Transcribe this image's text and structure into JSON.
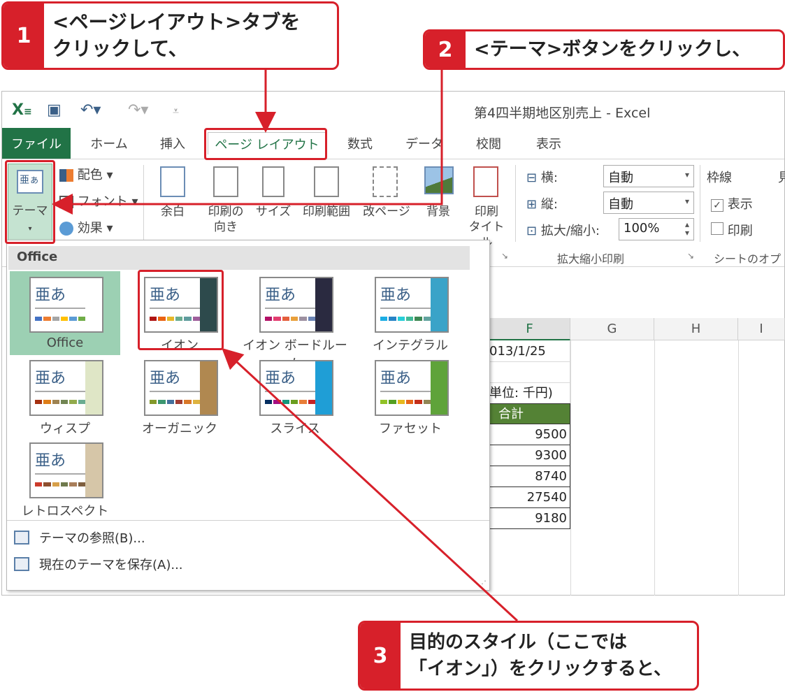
{
  "callouts": [
    {
      "num": "1",
      "text": "<ページレイアウト>タブを\nクリックして、"
    },
    {
      "num": "2",
      "text": "<テーマ>ボタンをクリックし、"
    },
    {
      "num": "3",
      "text": "目的のスタイル（ここでは\n「イオン」）をクリックすると、"
    }
  ],
  "window": {
    "title": "第4四半期地区別売上 - Excel"
  },
  "tabs": [
    "ファイル",
    "ホーム",
    "挿入",
    "ページ レイアウト",
    "数式",
    "データ",
    "校閲",
    "表示"
  ],
  "ribbon": {
    "theme_button": "テーマ",
    "theme_options": [
      "配色",
      "フォント",
      "効果"
    ],
    "page_setup": [
      {
        "label": "余白"
      },
      {
        "label": "印刷の\n向き"
      },
      {
        "label": "サイズ"
      },
      {
        "label": "印刷範囲"
      },
      {
        "label": "改ページ"
      },
      {
        "label": "背景"
      },
      {
        "label": "印刷\nタイトル"
      }
    ],
    "scale": {
      "width_label": "横:",
      "width_value": "自動",
      "height_label": "縦:",
      "height_value": "自動",
      "zoom_label": "拡大/縮小:",
      "zoom_value": "100%",
      "group_label": "拡大縮小印刷"
    },
    "gridlines": {
      "group_title": "枠線",
      "view_label": "表示",
      "print_label": "印刷",
      "view_checked": true,
      "print_checked": false,
      "group_label": "シートのオプ",
      "next_group_fragment": "見"
    }
  },
  "gallery": {
    "header": "Office",
    "themes": [
      {
        "name": "Office",
        "colors": [
          "#4472c4",
          "#ed7d31",
          "#a5a5a5",
          "#ffc000",
          "#5b9bd5",
          "#70ad47"
        ],
        "side": "#ffffff",
        "selected": true
      },
      {
        "name": "イオン",
        "colors": [
          "#b01513",
          "#ea6312",
          "#e6b729",
          "#6aac90",
          "#5f9c9d",
          "#9e5e9b"
        ],
        "side": "#2d4a4c"
      },
      {
        "name": "イオン ボードルーム",
        "colors": [
          "#b31166",
          "#e33d6f",
          "#e45f3c",
          "#e9a03b",
          "#9d90a0",
          "#6c85b6"
        ],
        "side": "#2a2a40"
      },
      {
        "name": "インテグラル",
        "colors": [
          "#1cade4",
          "#2683c6",
          "#27ced7",
          "#42ba97",
          "#3e8853",
          "#62a39f"
        ],
        "side": "#3aa3c8"
      },
      {
        "name": "ウィスプ",
        "colors": [
          "#a53010",
          "#de7e18",
          "#9f8351",
          "#728653",
          "#92aa4c",
          "#6aac91"
        ],
        "side": "#dfe6c6"
      },
      {
        "name": "オーガニック",
        "colors": [
          "#83992a",
          "#3c9770",
          "#44709d",
          "#a23c33",
          "#d97828",
          "#deb340"
        ],
        "side": "#b08850"
      },
      {
        "name": "スライス",
        "colors": [
          "#052f61",
          "#a50e82",
          "#14967c",
          "#6a9e1f",
          "#e87d37",
          "#c62324"
        ],
        "side": "#1f9ed6"
      },
      {
        "name": "ファセット",
        "colors": [
          "#90c226",
          "#54a021",
          "#e6b91e",
          "#e76618",
          "#c42f1a",
          "#918655"
        ],
        "side": "#5fa33a"
      },
      {
        "name": "レトロスペクト",
        "colors": [
          "#cc3b2b",
          "#8f4f2f",
          "#d7a04a",
          "#6f7a4d",
          "#a87e5a",
          "#7f5f3f"
        ],
        "side": "#d6c6a8"
      }
    ],
    "menu": [
      "テーマの参照(B)...",
      "現在のテーマを保存(A)..."
    ]
  },
  "sheet": {
    "columns": [
      "F",
      "G",
      "H",
      "I"
    ],
    "cells": [
      "013/1/25",
      "単位: 千円)",
      "合計",
      "9500",
      "9300",
      "8740",
      "27540",
      "9180"
    ]
  },
  "colors": {
    "accent": "#217346",
    "callout": "#d7202a",
    "header_fill": "#548235"
  }
}
